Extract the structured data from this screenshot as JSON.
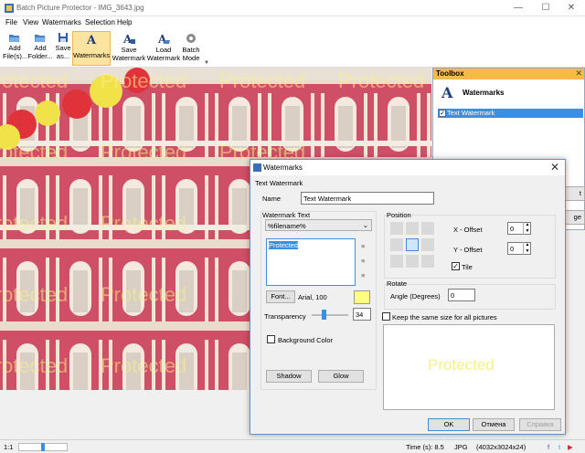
{
  "window": {
    "title": "Batch Picture Protector - IMG_3643.jpg",
    "controls": {
      "minimize": "—",
      "maximize": "☐",
      "close": "✕"
    }
  },
  "menu": [
    "File",
    "View",
    "Watermarks",
    "Selection",
    "Help"
  ],
  "toolbar": {
    "add_files": "Add File(s)...",
    "add_folder": "Add Folder...",
    "save_as": "Save as...",
    "watermarks": "Watermarks",
    "save_watermark": "Save Watermark",
    "load_watermark": "Load Watermark",
    "batch_mode": "Batch Mode"
  },
  "photo": {
    "watermark_text": "Protected"
  },
  "toolbox": {
    "title": "Toolbox",
    "heading": "Watermarks",
    "items": [
      {
        "label": "Text Watermark",
        "checked": true
      }
    ],
    "side_button_1": "t",
    "side_button_2": "ge"
  },
  "dialog": {
    "title": "Watermarks",
    "section": "Text Watermark",
    "name_label": "Name",
    "name_value": "Text Watermark",
    "watermark_text_group": "Watermark Text",
    "filename_option": "%filename%",
    "text_value": "Protected",
    "font_button": "Font...",
    "font_value": "Arial, 100",
    "color": "#ffff80",
    "transparency_label": "Transparency",
    "transparency_value": "34",
    "background_color_label": "Background Color",
    "background_color_checked": false,
    "shadow_button": "Shadow",
    "glow_button": "Glow",
    "position_group": "Position",
    "x_offset_label": "X - Offset",
    "x_offset_value": "0",
    "y_offset_label": "Y - Offset",
    "y_offset_value": "0",
    "tile_label": "Tile",
    "tile_checked": true,
    "rotate_group": "Rotate",
    "angle_label": "Angle (Degrees)",
    "angle_value": "0",
    "keep_size_label": "Keep the same size for all pictures",
    "keep_size_checked": false,
    "preview_text": "Protected",
    "ok_button": "OK",
    "cancel_button": "Отмена",
    "apply_button": "Справка"
  },
  "status": {
    "zoom": "1:1",
    "time": "Time (s): 8.5",
    "format": "JPG",
    "dimensions": "(4032x3024x24)"
  },
  "colors": {
    "accent": "#3b8ee0",
    "toolbox_title": "#f5b94e",
    "active_tool": "#fce4a0",
    "building": "#cf4f66"
  }
}
